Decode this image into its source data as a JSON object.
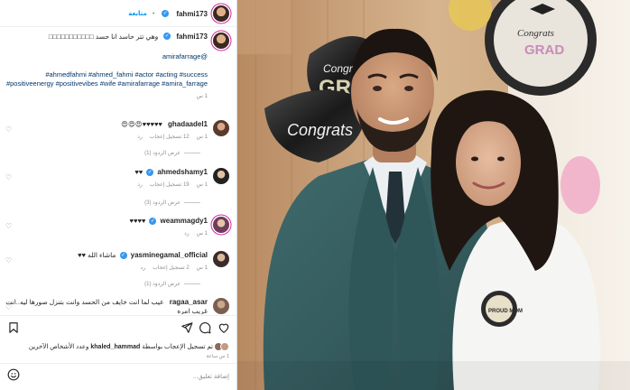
{
  "post": {
    "author": "fahmi173",
    "follow_label": "متابعة",
    "separator": "•"
  },
  "caption": {
    "author": "fahmi173",
    "text": "وهي تتر حاسد انا حسد □□□□□□□□□□□",
    "mention": "@amirafarrage",
    "hashtags": "#ahmedfahmi #ahmed_fahmi #actor #acting #success #positiveenergy #positivevibes #wife #amirafarrage #amira_farrage",
    "time": "1 س"
  },
  "comments": [
    {
      "user": "ghadaadel1",
      "text": "♥♥♥♥♥😍😍😍",
      "time": "1 س",
      "likes": "12 تسجيل إعجاب",
      "reply": "رد",
      "view_replies": "عرض الردود (1)"
    },
    {
      "user": "ahmedshamy1",
      "text": "♥♥",
      "time": "1 س",
      "likes": "19 تسجيل إعجاب",
      "reply": "رد",
      "view_replies": "عرض الردود (3)"
    },
    {
      "user": "weammagdy1",
      "text": "♥♥♥♥",
      "time": "1 س",
      "likes": "",
      "reply": "رد",
      "view_replies": ""
    },
    {
      "user": "yasminegamal_official",
      "text": "ماشاء الله ♥♥",
      "time": "1 س",
      "likes": "2 تسجيل إعجاب",
      "reply": "رد",
      "view_replies": "عرض الردود (1)"
    },
    {
      "user": "ragaa_asar",
      "text": "عيب لما انت خايف من الحسد وانت بتنزل صورها ليه..انت غريب امره",
      "time": "",
      "likes": "",
      "reply": "",
      "view_replies": ""
    }
  ],
  "likes": {
    "text_prefix": "تم تسجيل الإعجاب بواسطة",
    "user": "khaled_hammad",
    "text_suffix": "وعدد الأشخاص الآخرين"
  },
  "post_ago": "1 س ساعة",
  "composer": {
    "placeholder": "إضافة تعليق..."
  },
  "photo": {
    "balloon_1": "Congrats",
    "balloon_2": "GRAD",
    "balloon_3": "Congrats GRAD!",
    "badge": "PROUD MOM"
  },
  "colors": {
    "accent": "#0095f6",
    "verified": "#3897f0",
    "muted": "#8e8e8e"
  }
}
